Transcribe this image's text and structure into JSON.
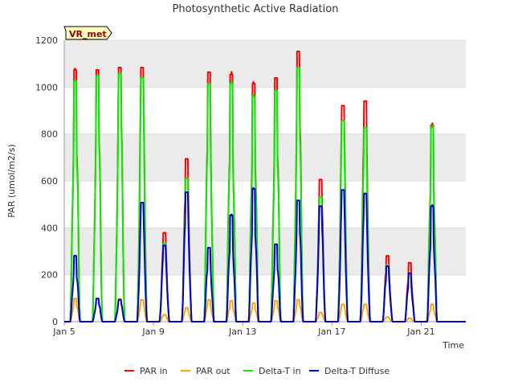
{
  "chart_data": {
    "type": "line",
    "title": "Photosynthetic Active Radiation",
    "xlabel": "Time",
    "ylabel": "PAR (umol/m2/s)",
    "site_label": "VR_met",
    "ylim": [
      0,
      1200
    ],
    "xlim": [
      "2024-01-05",
      "2024-01-23"
    ],
    "y_ticks": [
      0,
      200,
      400,
      600,
      800,
      1000,
      1200
    ],
    "x_ticks": [
      {
        "date": "2024-01-05",
        "label": "Jan 5"
      },
      {
        "date": "2024-01-09",
        "label": "Jan 9"
      },
      {
        "date": "2024-01-13",
        "label": "Jan 13"
      },
      {
        "date": "2024-01-17",
        "label": "Jan 17"
      },
      {
        "date": "2024-01-21",
        "label": "Jan 21"
      }
    ],
    "grid": true,
    "legend_position": "bottom",
    "band_fill": "#ebebeb",
    "days": [
      "2024-01-05",
      "2024-01-06",
      "2024-01-07",
      "2024-01-08",
      "2024-01-09",
      "2024-01-10",
      "2024-01-11",
      "2024-01-12",
      "2024-01-13",
      "2024-01-14",
      "2024-01-15",
      "2024-01-16",
      "2024-01-17",
      "2024-01-18",
      "2024-01-19",
      "2024-01-20",
      "2024-01-21",
      "2024-01-22"
    ],
    "series": [
      {
        "name": "PAR in",
        "color": "#ff0000",
        "daily_peak": [
          1090,
          1090,
          1100,
          1100,
          385,
          705,
          1080,
          1070,
          1030,
          1055,
          1170,
          615,
          935,
          955,
          285,
          255,
          850,
          0
        ]
      },
      {
        "name": "PAR out",
        "color": "#ffa500",
        "daily_peak": [
          100,
          100,
          100,
          95,
          30,
          60,
          95,
          90,
          80,
          90,
          95,
          40,
          75,
          75,
          20,
          15,
          75,
          0
        ]
      },
      {
        "name": "Delta-T in",
        "color": "#00ee00",
        "daily_peak": [
          1040,
          1065,
          1075,
          1055,
          340,
          620,
          1030,
          1030,
          975,
          1000,
          1100,
          540,
          870,
          840,
          245,
          210,
          840,
          0
        ]
      },
      {
        "name": "Delta-T Diffuse",
        "color": "#0000cc",
        "daily_peak": [
          285,
          100,
          95,
          515,
          330,
          560,
          320,
          460,
          575,
          335,
          525,
          500,
          570,
          555,
          240,
          210,
          500,
          0
        ]
      }
    ]
  }
}
